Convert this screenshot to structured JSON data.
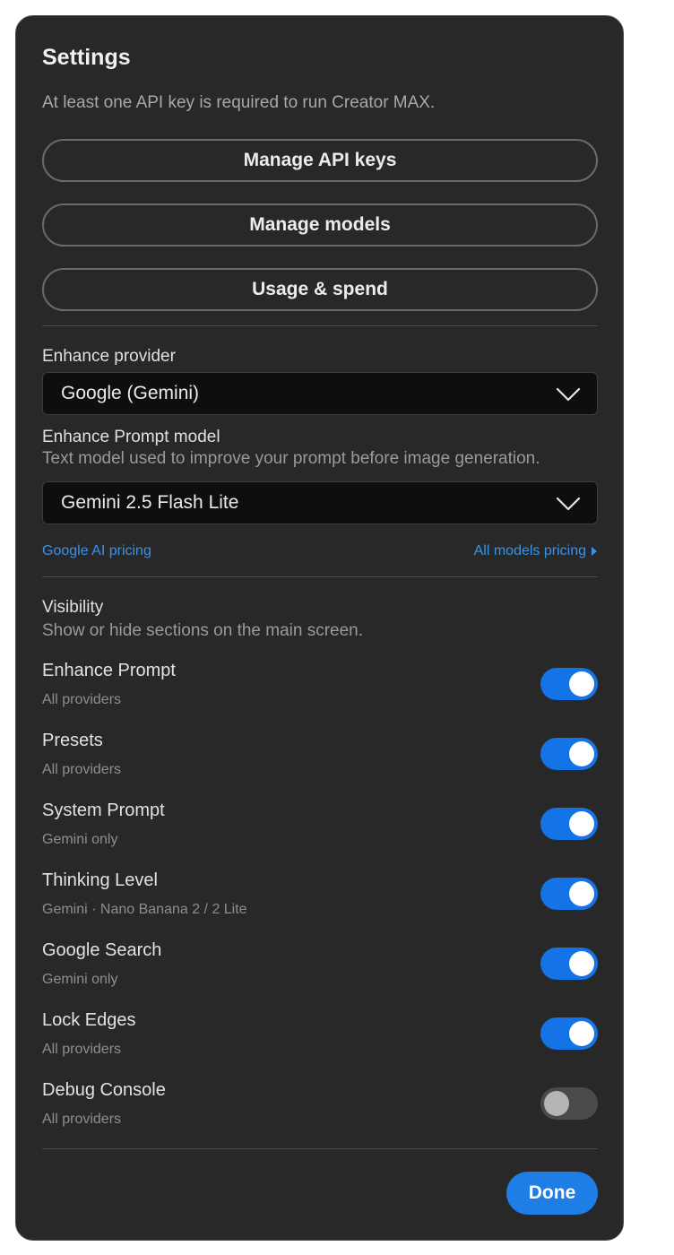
{
  "dialog": {
    "title": "Settings",
    "subtitle": "At least one API key is required to run Creator MAX."
  },
  "buttons": {
    "manage_api_keys": "Manage API keys",
    "manage_models": "Manage models",
    "usage_spend": "Usage & spend",
    "done": "Done"
  },
  "enhance_provider": {
    "label": "Enhance provider",
    "selected": "Google (Gemini)"
  },
  "enhance_prompt_model": {
    "label": "Enhance Prompt model",
    "hint": "Text model used to improve your prompt before image generation.",
    "selected": "Gemini 2.5 Flash Lite"
  },
  "links": {
    "google_ai_pricing": "Google AI pricing",
    "all_models_pricing": "All models pricing"
  },
  "visibility": {
    "title": "Visibility",
    "hint": "Show or hide sections on the main screen.",
    "items": [
      {
        "label": "Enhance Prompt",
        "sub": "All providers",
        "on": true
      },
      {
        "label": "Presets",
        "sub": "All providers",
        "on": true
      },
      {
        "label": "System Prompt",
        "sub": "Gemini only",
        "on": true
      },
      {
        "label": "Thinking Level",
        "sub": "Gemini · Nano Banana 2 / 2 Lite",
        "on": true
      },
      {
        "label": "Google Search",
        "sub": "Gemini only",
        "on": true
      },
      {
        "label": "Lock Edges",
        "sub": "All providers",
        "on": true
      },
      {
        "label": "Debug Console",
        "sub": "All providers",
        "on": false
      }
    ]
  },
  "colors": {
    "accent": "#1473e6",
    "link": "#3a92e8",
    "panel_bg": "#282828"
  },
  "icons": {
    "dropdown": "chevron-down-icon",
    "link_arrow": "triangle-right-icon"
  }
}
